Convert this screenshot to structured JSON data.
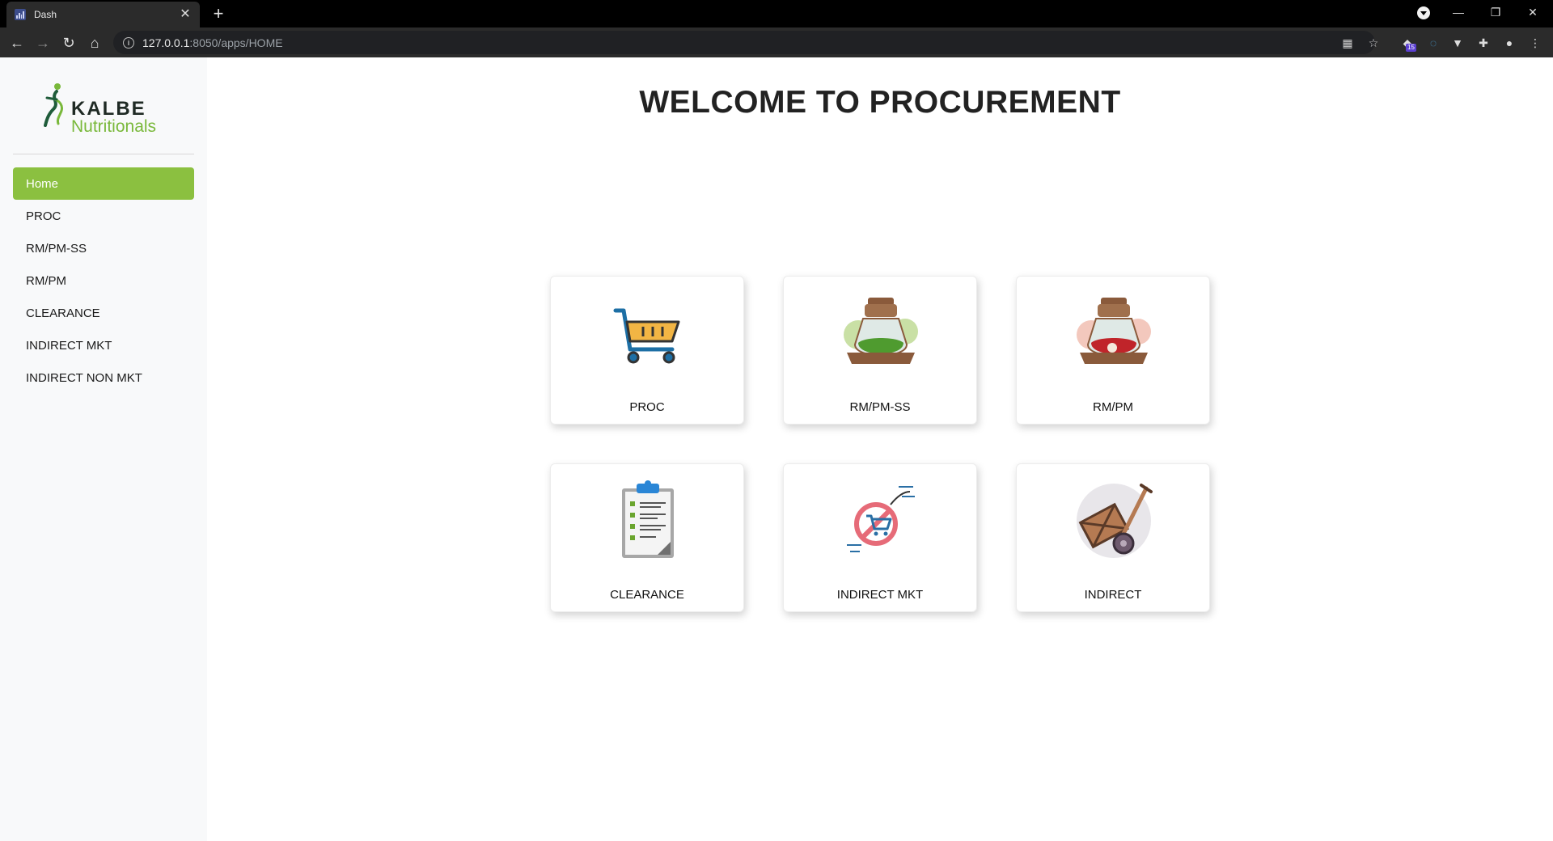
{
  "browser": {
    "tab_title": "Dash",
    "url_host": "127.0.0.1",
    "url_path": ":8050/apps/HOME",
    "extension_badge": "15"
  },
  "sidebar": {
    "brand": {
      "line1": "KALBE",
      "line2": "Nutritionals",
      "colors": {
        "green": "#79b83a",
        "dark": "#1f2a24"
      }
    },
    "items": [
      {
        "label": "Home",
        "active": true
      },
      {
        "label": "PROC",
        "active": false
      },
      {
        "label": "RM/PM-SS",
        "active": false
      },
      {
        "label": "RM/PM",
        "active": false
      },
      {
        "label": "CLEARANCE",
        "active": false
      },
      {
        "label": "INDIRECT MKT",
        "active": false
      },
      {
        "label": "INDIRECT NON MKT",
        "active": false
      }
    ],
    "active_color": "#8bc040"
  },
  "main": {
    "title": "WELCOME TO PROCUREMENT",
    "cards": [
      {
        "label": "PROC",
        "icon": "shopping-cart-icon"
      },
      {
        "label": "RM/PM-SS",
        "icon": "green-spice-jar-icon"
      },
      {
        "label": "RM/PM",
        "icon": "red-spice-jar-icon"
      },
      {
        "label": "CLEARANCE",
        "icon": "clipboard-checklist-icon"
      },
      {
        "label": "INDIRECT MKT",
        "icon": "fast-cart-icon"
      },
      {
        "label": "INDIRECT",
        "icon": "hand-truck-icon"
      }
    ]
  }
}
